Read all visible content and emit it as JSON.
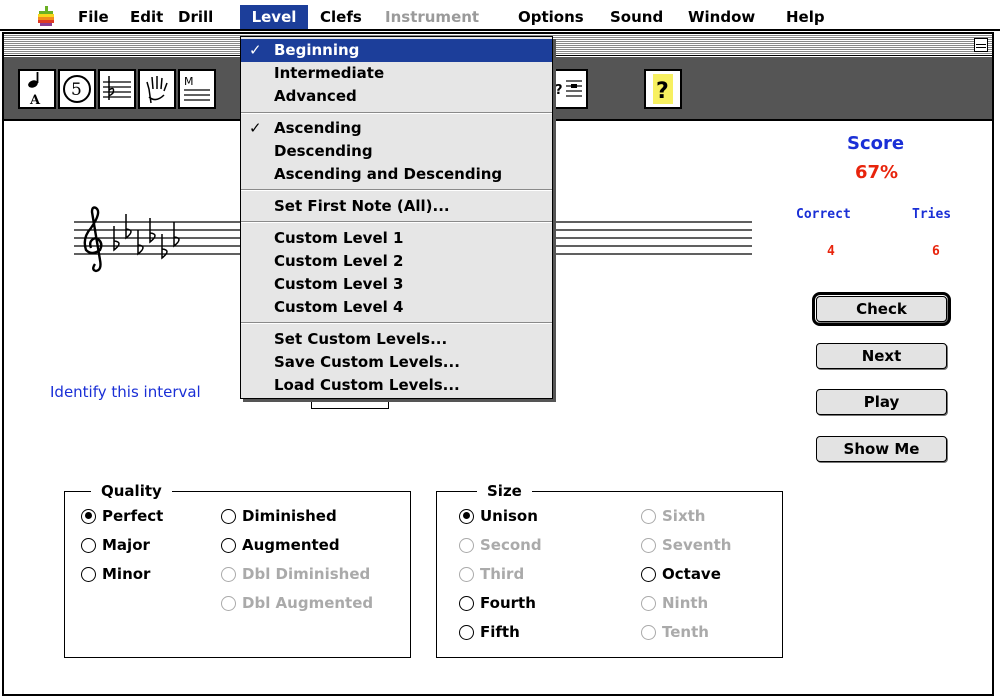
{
  "menubar": {
    "items": [
      {
        "label": "File"
      },
      {
        "label": "Edit"
      },
      {
        "label": "Drill"
      },
      {
        "label": "Level"
      },
      {
        "label": "Clefs"
      },
      {
        "label": "Instrument"
      },
      {
        "label": "Options"
      },
      {
        "label": "Sound"
      },
      {
        "label": "Window"
      },
      {
        "label": "Help"
      }
    ]
  },
  "level_menu": {
    "items": [
      {
        "label": "Beginning",
        "checked": true
      },
      {
        "label": "Intermediate"
      },
      {
        "label": "Advanced"
      },
      {
        "label": "Ascending",
        "checked": true
      },
      {
        "label": "Descending"
      },
      {
        "label": "Ascending and Descending"
      },
      {
        "label": "Set First Note (All)..."
      },
      {
        "label": "Custom Level  1"
      },
      {
        "label": "Custom Level  2"
      },
      {
        "label": "Custom Level  3"
      },
      {
        "label": "Custom Level  4"
      },
      {
        "label": "Set Custom Levels..."
      },
      {
        "label": "Save Custom Levels..."
      },
      {
        "label": "Load Custom Levels..."
      }
    ],
    "check_glyph": "✓"
  },
  "toolbar": {
    "icons": [
      "note-a-icon",
      "circle-five-icon",
      "staff-icon",
      "hand-icon",
      "staff-m-icon",
      "staff-note-icon",
      "question-staff-icon",
      "help-icon"
    ],
    "circle_label": "5",
    "note_label": "A",
    "help_label": "?"
  },
  "score": {
    "title": "Score",
    "percent": "67%",
    "correct_label": "Correct",
    "tries_label": "Tries",
    "correct": "4",
    "tries": "6"
  },
  "buttons": {
    "check": "Check",
    "next": "Next",
    "play": "Play",
    "show_me": "Show Me"
  },
  "prompt": "Identify this interval",
  "quality": {
    "title": "Quality",
    "options": [
      {
        "label": "Perfect",
        "selected": true,
        "enabled": true
      },
      {
        "label": "Major",
        "selected": false,
        "enabled": true
      },
      {
        "label": "Minor",
        "selected": false,
        "enabled": true
      },
      {
        "label": "Diminished",
        "selected": false,
        "enabled": true
      },
      {
        "label": "Augmented",
        "selected": false,
        "enabled": true
      },
      {
        "label": "Dbl Diminished",
        "selected": false,
        "enabled": false
      },
      {
        "label": "Dbl Augmented",
        "selected": false,
        "enabled": false
      }
    ]
  },
  "size": {
    "title": "Size",
    "options": [
      {
        "label": "Unison",
        "selected": true,
        "enabled": true
      },
      {
        "label": "Second",
        "selected": false,
        "enabled": false
      },
      {
        "label": "Third",
        "selected": false,
        "enabled": false
      },
      {
        "label": "Fourth",
        "selected": false,
        "enabled": true
      },
      {
        "label": "Fifth",
        "selected": false,
        "enabled": true
      },
      {
        "label": "Sixth",
        "selected": false,
        "enabled": false
      },
      {
        "label": "Seventh",
        "selected": false,
        "enabled": false
      },
      {
        "label": "Octave",
        "selected": false,
        "enabled": true
      },
      {
        "label": "Ninth",
        "selected": false,
        "enabled": false
      },
      {
        "label": "Tenth",
        "selected": false,
        "enabled": false
      }
    ]
  },
  "colors": {
    "accent": "#1c3e9a",
    "score_blue": "#1a2fd6",
    "score_red": "#e8240c"
  }
}
